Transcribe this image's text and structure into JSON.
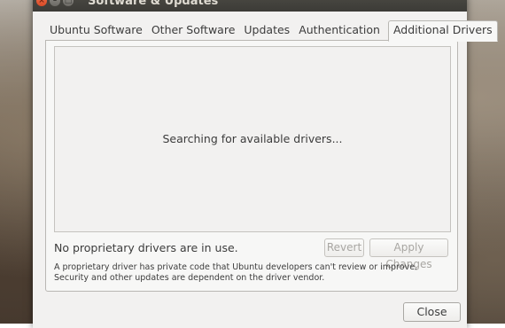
{
  "window": {
    "title": "Software & Updates",
    "controls": {
      "close_icon": "×",
      "minimize_icon": "–",
      "maximize_icon": "□"
    }
  },
  "tabs": [
    {
      "label": "Ubuntu Software",
      "active": false
    },
    {
      "label": "Other Software",
      "active": false
    },
    {
      "label": "Updates",
      "active": false
    },
    {
      "label": "Authentication",
      "active": false
    },
    {
      "label": "Additional Drivers",
      "active": true
    }
  ],
  "drivers": {
    "searching_text": "Searching for available drivers...",
    "status_text": "No proprietary drivers are in use.",
    "revert_label": "Revert",
    "apply_label": "Apply Changes",
    "info_text": "A proprietary driver has private code that Ubuntu developers can't review or improve. Security and other updates are dependent on the driver vendor."
  },
  "footer": {
    "close_label": "Close"
  }
}
